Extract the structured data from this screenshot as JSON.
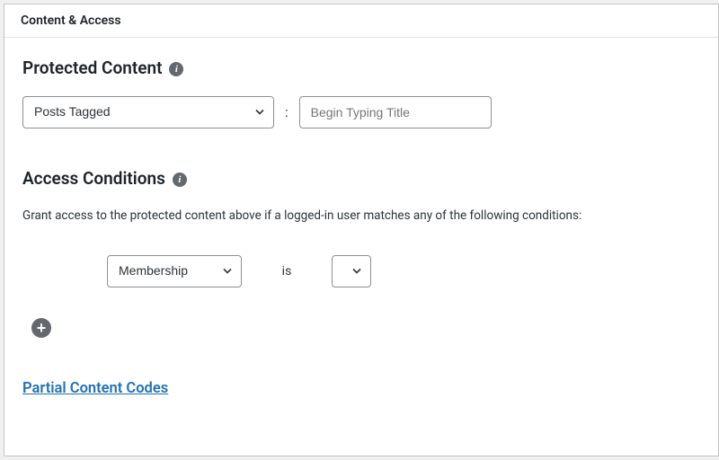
{
  "panel": {
    "title": "Content & Access"
  },
  "protected": {
    "heading": "Protected Content",
    "info_glyph": "i",
    "type_select_value": "Posts Tagged",
    "separator": ":",
    "title_placeholder": "Begin Typing Title"
  },
  "access": {
    "heading": "Access Conditions",
    "info_glyph": "i",
    "help_text": "Grant access to the protected content above if a logged-in user matches any of the following conditions:",
    "condition": {
      "field_value": "Membership",
      "operator_label": "is",
      "value_selected": ""
    },
    "add_glyph": "+"
  },
  "link": {
    "partial_codes": "Partial Content Codes"
  }
}
